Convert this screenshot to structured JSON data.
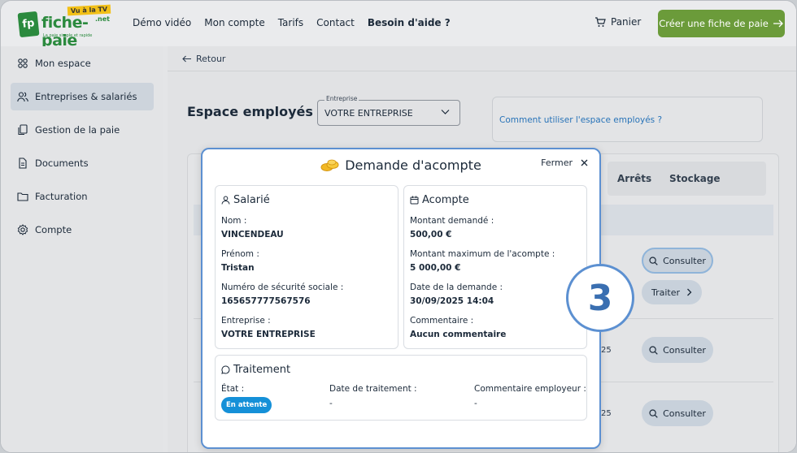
{
  "header": {
    "logo_text": "fiche-paie",
    "logo_tv": "Vu à la TV",
    "logo_suffix": ".net",
    "logo_tagline": "La paie simple et rapide",
    "nav": [
      "Démo vidéo",
      "Mon compte",
      "Tarifs",
      "Contact",
      "Besoin d'aide ?"
    ],
    "cart_label": "Panier",
    "cta_label": "Créer une fiche de paie"
  },
  "sidebar": {
    "items": [
      {
        "label": "Mon espace",
        "icon": "grid-icon"
      },
      {
        "label": "Entreprises & salariés",
        "icon": "users-icon"
      },
      {
        "label": "Gestion de la paie",
        "icon": "copy-document-icon"
      },
      {
        "label": "Documents",
        "icon": "file-icon"
      },
      {
        "label": "Facturation",
        "icon": "folder-icon"
      },
      {
        "label": "Compte",
        "icon": "gear-icon"
      }
    ],
    "active_index": 1
  },
  "main": {
    "back_label": "Retour",
    "title": "Espace employés de",
    "company_select": {
      "label": "Entreprise",
      "value": "VOTRE ENTREPRISE"
    },
    "help_link": "Comment utiliser l'espace employés ?",
    "tabs": [
      "Arrêts",
      "Stockage"
    ],
    "row_fragments": [
      "25",
      "25"
    ],
    "consult_label": "Consulter",
    "traiter_label": "Traiter"
  },
  "modal": {
    "title": "Demande d'acompte",
    "close_label": "Fermer",
    "salarie": {
      "title": "Salarié",
      "nom_label": "Nom :",
      "nom": "VINCENDEAU",
      "prenom_label": "Prénom :",
      "prenom": "Tristan",
      "nss_label": "Numéro de sécurité sociale :",
      "nss": "165657777567576",
      "entreprise_label": "Entreprise :",
      "entreprise": "VOTRE ENTREPRISE"
    },
    "acompte": {
      "title": "Acompte",
      "montant_label": "Montant demandé :",
      "montant": "500,00 €",
      "max_label": "Montant maximum de l'acompte :",
      "max": "5 000,00 €",
      "date_label": "Date de la demande :",
      "date": "30/09/2025 14:04",
      "comment_label": "Commentaire :",
      "comment": "Aucun commentaire"
    },
    "traitement": {
      "title": "Traitement",
      "etat_label": "État :",
      "etat": "En attente",
      "date_label": "Date de traitement :",
      "date": "-",
      "comment_label": "Commentaire employeur :",
      "comment": "-"
    }
  },
  "step_number": "3",
  "colors": {
    "accent_green": "#6b9b3a",
    "modal_border": "#5c90d1",
    "badge_blue": "#1590d8",
    "link_blue": "#2873b8"
  }
}
